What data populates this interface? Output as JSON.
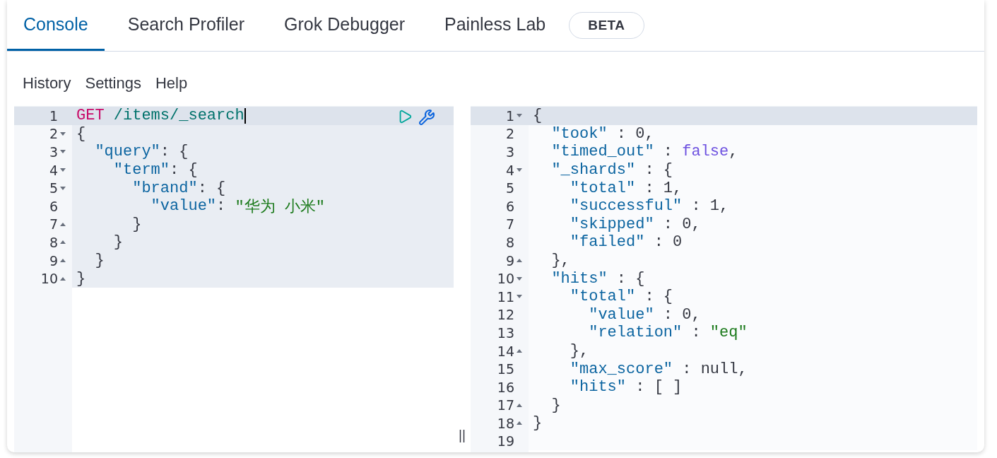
{
  "tabs": [
    {
      "label": "Console",
      "selected": true
    },
    {
      "label": "Search Profiler",
      "selected": false
    },
    {
      "label": "Grok Debugger",
      "selected": false
    },
    {
      "label": "Painless Lab",
      "selected": false,
      "badge": "BETA"
    }
  ],
  "menu": [
    "History",
    "Settings",
    "Help"
  ],
  "request_editor": {
    "lines": [
      {
        "number": "1",
        "kind": "plain",
        "selected": true,
        "tokens": [
          {
            "t": "GET",
            "kind": "method"
          },
          {
            "t": " /items/_search",
            "kind": "url"
          }
        ]
      },
      {
        "number": "2",
        "kind": "fold_start",
        "selected": false,
        "tokens": [
          {
            "t": "{",
            "kind": "punct"
          }
        ]
      },
      {
        "number": "3",
        "kind": "fold_start",
        "selected": false,
        "tokens": [
          {
            "t": "  \"query\"",
            "kind": "key"
          },
          {
            "t": ": {",
            "kind": "punct"
          }
        ]
      },
      {
        "number": "4",
        "kind": "fold_start",
        "selected": false,
        "tokens": [
          {
            "t": "    \"term\"",
            "kind": "key"
          },
          {
            "t": ": {",
            "kind": "punct"
          }
        ]
      },
      {
        "number": "5",
        "kind": "fold_start",
        "selected": false,
        "tokens": [
          {
            "t": "      \"brand\"",
            "kind": "key"
          },
          {
            "t": ": {",
            "kind": "punct"
          }
        ]
      },
      {
        "number": "6",
        "kind": "plain",
        "selected": false,
        "tokens": [
          {
            "t": "        \"value\"",
            "kind": "key"
          },
          {
            "t": ": ",
            "kind": "punct"
          },
          {
            "t": "\"华为 小米\"",
            "kind": "string"
          }
        ]
      },
      {
        "number": "7",
        "kind": "fold_end",
        "selected": false,
        "tokens": [
          {
            "t": "      }",
            "kind": "punct"
          }
        ]
      },
      {
        "number": "8",
        "kind": "fold_end",
        "selected": false,
        "tokens": [
          {
            "t": "    }",
            "kind": "punct"
          }
        ]
      },
      {
        "number": "9",
        "kind": "fold_end",
        "selected": false,
        "tokens": [
          {
            "t": "  }",
            "kind": "punct"
          }
        ]
      },
      {
        "number": "10",
        "kind": "fold_end",
        "selected": false,
        "tokens": [
          {
            "t": "}",
            "kind": "punct"
          }
        ]
      }
    ]
  },
  "response_editor": {
    "lines": [
      {
        "number": "1",
        "kind": "fold_start",
        "selected": true,
        "tokens": [
          {
            "t": "{",
            "kind": "punct"
          }
        ]
      },
      {
        "number": "2",
        "kind": "plain",
        "selected": false,
        "tokens": [
          {
            "t": "  \"took\"",
            "kind": "key"
          },
          {
            "t": " : 0,",
            "kind": "punct"
          }
        ]
      },
      {
        "number": "3",
        "kind": "plain",
        "selected": false,
        "tokens": [
          {
            "t": "  \"timed_out\"",
            "kind": "key"
          },
          {
            "t": " : ",
            "kind": "punct"
          },
          {
            "t": "false",
            "kind": "boolean"
          },
          {
            "t": ",",
            "kind": "punct"
          }
        ]
      },
      {
        "number": "4",
        "kind": "fold_start",
        "selected": false,
        "tokens": [
          {
            "t": "  \"_shards\"",
            "kind": "key"
          },
          {
            "t": " : {",
            "kind": "punct"
          }
        ]
      },
      {
        "number": "5",
        "kind": "plain",
        "selected": false,
        "tokens": [
          {
            "t": "    \"total\"",
            "kind": "key"
          },
          {
            "t": " : 1,",
            "kind": "punct"
          }
        ]
      },
      {
        "number": "6",
        "kind": "plain",
        "selected": false,
        "tokens": [
          {
            "t": "    \"successful\"",
            "kind": "key"
          },
          {
            "t": " : 1,",
            "kind": "punct"
          }
        ]
      },
      {
        "number": "7",
        "kind": "plain",
        "selected": false,
        "tokens": [
          {
            "t": "    \"skipped\"",
            "kind": "key"
          },
          {
            "t": " : 0,",
            "kind": "punct"
          }
        ]
      },
      {
        "number": "8",
        "kind": "plain",
        "selected": false,
        "tokens": [
          {
            "t": "    \"failed\"",
            "kind": "key"
          },
          {
            "t": " : 0",
            "kind": "punct"
          }
        ]
      },
      {
        "number": "9",
        "kind": "fold_end",
        "selected": false,
        "tokens": [
          {
            "t": "  },",
            "kind": "punct"
          }
        ]
      },
      {
        "number": "10",
        "kind": "fold_start",
        "selected": false,
        "tokens": [
          {
            "t": "  \"hits\"",
            "kind": "key"
          },
          {
            "t": " : {",
            "kind": "punct"
          }
        ]
      },
      {
        "number": "11",
        "kind": "fold_start",
        "selected": false,
        "tokens": [
          {
            "t": "    \"total\"",
            "kind": "key"
          },
          {
            "t": " : {",
            "kind": "punct"
          }
        ]
      },
      {
        "number": "12",
        "kind": "plain",
        "selected": false,
        "tokens": [
          {
            "t": "      \"value\"",
            "kind": "key"
          },
          {
            "t": " : 0,",
            "kind": "punct"
          }
        ]
      },
      {
        "number": "13",
        "kind": "plain",
        "selected": false,
        "tokens": [
          {
            "t": "      \"relation\"",
            "kind": "key"
          },
          {
            "t": " : ",
            "kind": "punct"
          },
          {
            "t": "\"eq\"",
            "kind": "string"
          }
        ]
      },
      {
        "number": "14",
        "kind": "fold_end",
        "selected": false,
        "tokens": [
          {
            "t": "    },",
            "kind": "punct"
          }
        ]
      },
      {
        "number": "15",
        "kind": "plain",
        "selected": false,
        "tokens": [
          {
            "t": "    \"max_score\"",
            "kind": "key"
          },
          {
            "t": " : null,",
            "kind": "punct"
          }
        ]
      },
      {
        "number": "16",
        "kind": "plain",
        "selected": false,
        "tokens": [
          {
            "t": "    \"hits\"",
            "kind": "key"
          },
          {
            "t": " : [ ]",
            "kind": "punct"
          }
        ]
      },
      {
        "number": "17",
        "kind": "fold_end",
        "selected": false,
        "tokens": [
          {
            "t": "  }",
            "kind": "punct"
          }
        ]
      },
      {
        "number": "18",
        "kind": "fold_end",
        "selected": false,
        "tokens": [
          {
            "t": "}",
            "kind": "punct"
          }
        ]
      },
      {
        "number": "19",
        "kind": "plain",
        "selected": false
      }
    ]
  }
}
